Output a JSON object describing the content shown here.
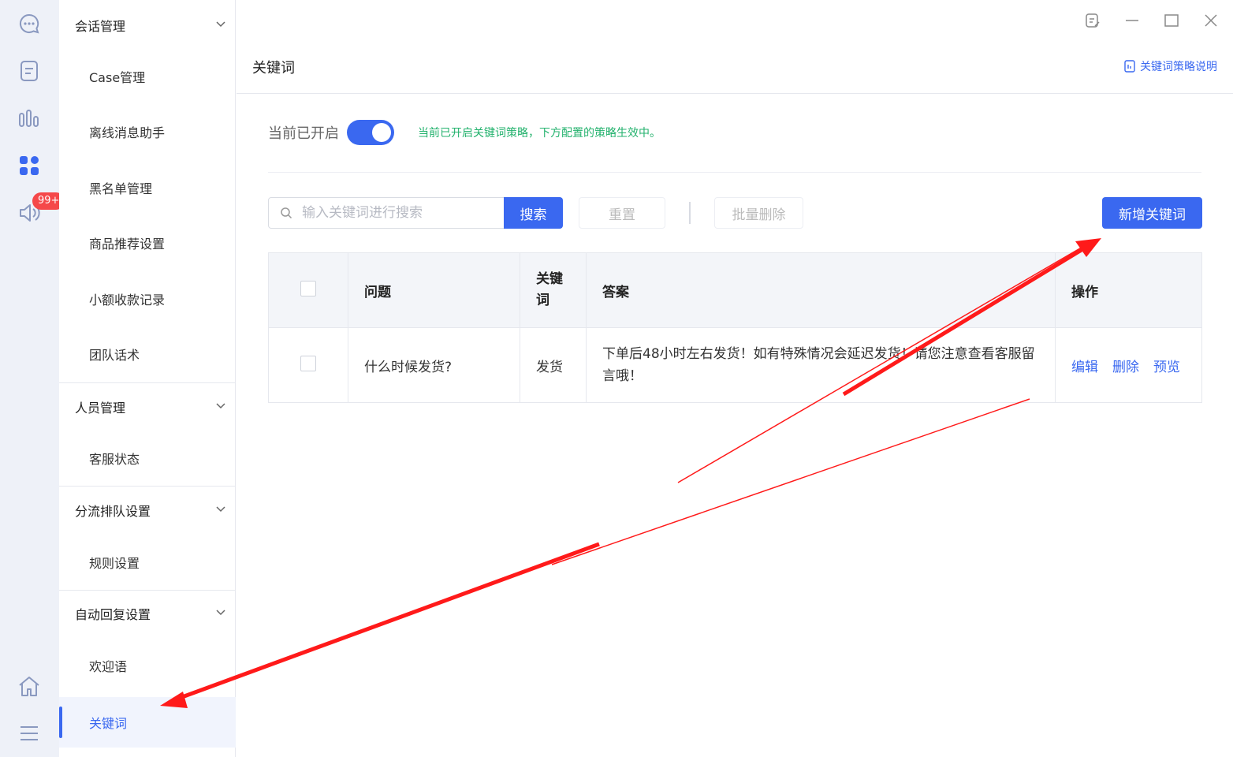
{
  "rail": {
    "icons": [
      "chat-icon",
      "document-icon",
      "stats-icon",
      "apps-icon",
      "speaker-icon"
    ],
    "badge": "99+",
    "bottom_icons": [
      "home-icon",
      "menu-icon"
    ]
  },
  "menu": {
    "groups": [
      {
        "label": "会话管理",
        "items": [
          "Case管理",
          "离线消息助手",
          "黑名单管理",
          "商品推荐设置",
          "小额收款记录",
          "团队话术"
        ]
      },
      {
        "label": "人员管理",
        "items": [
          "客服状态"
        ]
      },
      {
        "label": "分流排队设置",
        "items": [
          "规则设置"
        ]
      },
      {
        "label": "自动回复设置",
        "items": [
          "欢迎语",
          "关键词"
        ]
      }
    ],
    "active_item": "关键词"
  },
  "header": {
    "title": "关键词",
    "help_link": "关键词策略说明"
  },
  "toggle": {
    "label": "当前已开启",
    "on": true,
    "hint": "当前已开启关键词策略，下方配置的策略生效中。"
  },
  "toolbar": {
    "search_placeholder": "输入关键词进行搜索",
    "search_label": "搜索",
    "reset_label": "重置",
    "batch_delete_label": "批量删除",
    "add_label": "新增关键词"
  },
  "table": {
    "headers": [
      "问题",
      "关键词",
      "答案",
      "操作"
    ],
    "rows": [
      {
        "question": "什么时候发货?",
        "keyword": "发货",
        "answer": "下单后48小时左右发货！如有特殊情况会延迟发货！请您注意查看客服留言哦！",
        "actions": [
          "编辑",
          "删除",
          "预览"
        ]
      }
    ]
  },
  "colors": {
    "primary": "#3a68f0",
    "success": "#23b26d",
    "badge": "#f5484a",
    "annotation": "#ff1a1a"
  }
}
